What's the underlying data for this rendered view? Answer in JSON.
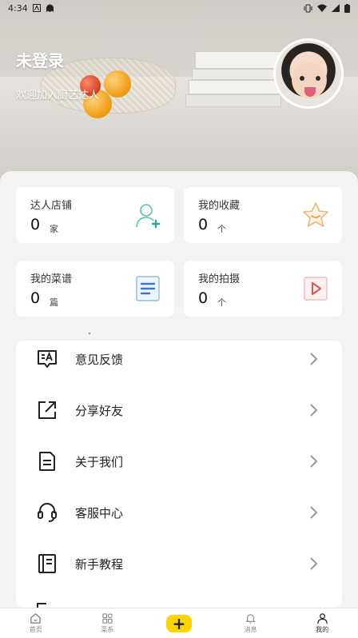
{
  "status_bar": {
    "time": "4:34",
    "left_icons": [
      "notification-a-icon",
      "ghost-app-icon"
    ],
    "right_icons": [
      "vibrate-icon",
      "wifi-icon",
      "signal-icon",
      "battery-icon"
    ]
  },
  "header": {
    "title": "未登录",
    "subtitle": "欢迎加入厨艺达人",
    "avatar": "avatar"
  },
  "stats": [
    {
      "label": "达人店铺",
      "value": "0",
      "unit": "家",
      "icon": "user-add-icon",
      "color": "#55c3b7"
    },
    {
      "label": "我的收藏",
      "value": "0",
      "unit": "个",
      "icon": "star-icon",
      "color": "#f5b57a"
    },
    {
      "label": "我的菜谱",
      "value": "0",
      "unit": "篇",
      "icon": "recipe-doc-icon",
      "color": "#3a77c9"
    },
    {
      "label": "我的拍摄",
      "value": "0",
      "unit": "个",
      "icon": "video-play-icon",
      "color": "#e0707a"
    }
  ],
  "menu": [
    {
      "label": "意见反馈",
      "icon": "feedback-icon"
    },
    {
      "label": "分享好友",
      "icon": "share-icon"
    },
    {
      "label": "关于我们",
      "icon": "document-icon"
    },
    {
      "label": "客服中心",
      "icon": "headset-icon"
    },
    {
      "label": "新手教程",
      "icon": "notebook-icon"
    }
  ],
  "bottom_nav": {
    "items": [
      {
        "label": "首页",
        "icon": "home-icon"
      },
      {
        "label": "菜系",
        "icon": "grid-icon"
      },
      {
        "label": "+",
        "icon": "plus-icon"
      },
      {
        "label": "消息",
        "icon": "bell-icon"
      },
      {
        "label": "我的",
        "icon": "profile-icon"
      }
    ],
    "active": "我的",
    "accent": "#ffd400"
  }
}
